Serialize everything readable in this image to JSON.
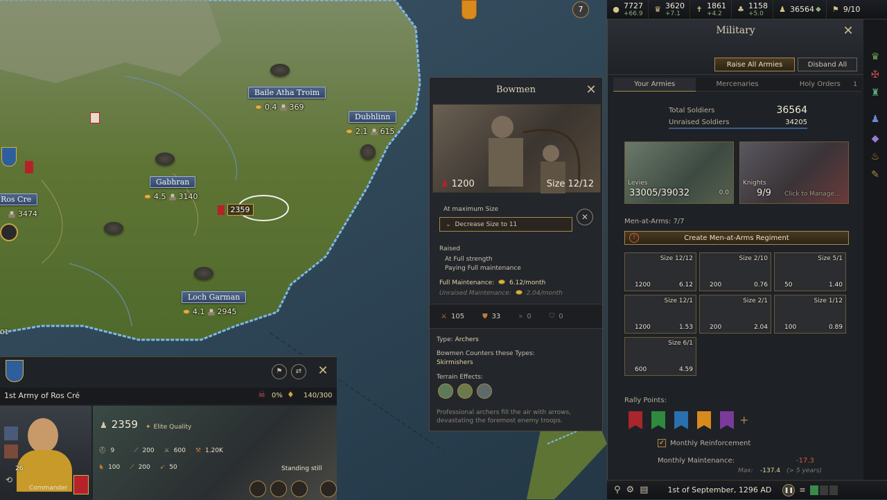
{
  "topbar": {
    "resources": [
      {
        "icon": "gold-icon",
        "value": "7727",
        "delta": "+66.9"
      },
      {
        "icon": "prestige-icon",
        "value": "3620",
        "delta": "+7.1"
      },
      {
        "icon": "piety-icon",
        "value": "1861",
        "delta": "+4.2"
      },
      {
        "icon": "renown-icon",
        "value": "1158",
        "delta": "+5.0"
      },
      {
        "icon": "soldiers-icon",
        "value": "36564",
        "delta": ""
      },
      {
        "icon": "domain-icon",
        "value": "9/10",
        "delta": ""
      }
    ]
  },
  "map": {
    "counties": [
      {
        "name": "Baile Atha Troim",
        "gold": "0.4",
        "men": "369"
      },
      {
        "name": "Dubhlinn",
        "gold": "2.1",
        "men": "615"
      },
      {
        "name": "Gabhran",
        "gold": "4.5",
        "men": "3140"
      },
      {
        "name": "Ros Cre",
        "gold": "",
        "men": "3474"
      },
      {
        "name": "Loch Garman",
        "gold": "4.1",
        "men": "2945"
      }
    ],
    "army_strength": "2359",
    "top_counter": "7",
    "edge_value": "01"
  },
  "military": {
    "title": "Military",
    "raise_all": "Raise All Armies",
    "disband_all": "Disband All",
    "tabs": [
      {
        "label": "Your Armies",
        "count": ""
      },
      {
        "label": "Mercenaries",
        "count": ""
      },
      {
        "label": "Holy Orders",
        "count": "1"
      }
    ],
    "total_soldiers_label": "Total Soldiers",
    "total_soldiers": "36564",
    "unraised_label": "Unraised Soldiers",
    "unraised": "34205",
    "levies_label": "Levies",
    "levies_value": "33005/39032",
    "levies_cost": "0.0",
    "knights_label": "Knights",
    "knights_value": "9/9",
    "knights_hint": "Click to Manage...",
    "maa_label": "Men-at-Arms: 7/7",
    "create_maa": "Create Men-at-Arms Regiment",
    "regiments": [
      {
        "size": "Size 12/12",
        "men": "1200",
        "cost": "6.12"
      },
      {
        "size": "Size 2/10",
        "men": "200",
        "cost": "0.76"
      },
      {
        "size": "Size 5/1",
        "men": "50",
        "cost": "1.40"
      },
      {
        "size": "Size 12/1",
        "men": "1200",
        "cost": "1.53"
      },
      {
        "size": "Size 2/1",
        "men": "200",
        "cost": "2.04"
      },
      {
        "size": "Size 1/12",
        "men": "100",
        "cost": "0.89"
      },
      {
        "size": "Size 6/1",
        "men": "600",
        "cost": "4.59"
      }
    ],
    "rally_label": "Rally Points:",
    "rally_colors": [
      "#a8262c",
      "#2e8a3c",
      "#2a6fae",
      "#d98a1c",
      "#7a3a9a"
    ],
    "monthly_reinforcement": "Monthly Reinforcement",
    "monthly_maintenance_label": "Monthly Maintenance:",
    "monthly_maintenance": "-17.3",
    "max_label": "Max:",
    "max_value": "-137.4",
    "max_years": "(> 5 years)"
  },
  "bottombar": {
    "date": "1st of September, 1296 AD"
  },
  "bowmen": {
    "title": "Bowmen",
    "men": "1200",
    "size": "Size 12/12",
    "at_max": "At maximum Size",
    "decrease": "Decrease Size to 11",
    "raised": "Raised",
    "full_strength": "At Full strength",
    "paying": "Paying Full maintenance",
    "full_maint_label": "Full Maintenance:",
    "full_maint": "6.12/month",
    "unraised_maint_label": "Unraised Maintenance:",
    "unraised_maint": "2.04/month",
    "stats": {
      "damage": "105",
      "toughness": "33",
      "pursuit": "0",
      "screen": "0"
    },
    "type_label": "Type:",
    "type": "Archers",
    "counters_label": "Bowmen Counters these Types:",
    "counters": "Skirmishers",
    "terrain_label": "Terrain Effects:",
    "description": "Professional archers fill the air with arrows, devastating the foremost enemy troops."
  },
  "army": {
    "name": "1st Army of Ros Cré",
    "casualty": "0%",
    "supply": "140/300",
    "men": "2359",
    "quality": "Elite Quality",
    "stats": {
      "a": "9",
      "b": "200",
      "c": "600",
      "d": "1.20K",
      "e": "100",
      "f": "200",
      "g": "50"
    },
    "commander_label": "Commander",
    "commander_level": "26",
    "status": "Standing still"
  }
}
